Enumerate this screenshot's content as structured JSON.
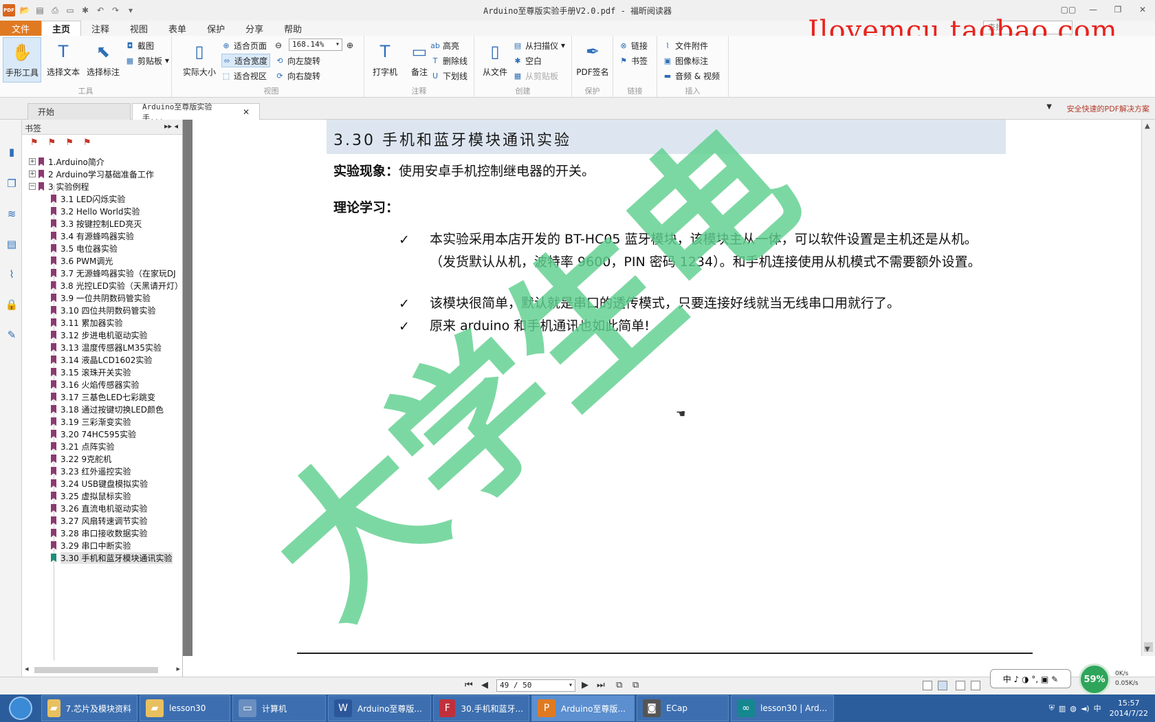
{
  "window": {
    "title": "Arduino至尊版实验手册V2.0.pdf - 福昕阅读器",
    "app_logo": "PDF",
    "controls": [
      "▢▢",
      "—",
      "❐",
      "✕"
    ]
  },
  "watermark_top": "Ilovemcu.taobao.com",
  "menu": {
    "tabs": [
      "文件",
      "主页",
      "注释",
      "视图",
      "表单",
      "保护",
      "分享",
      "帮助"
    ],
    "active": "主页",
    "search_placeholder": "查找"
  },
  "ribbon": {
    "tools": {
      "label": "工具",
      "hand": "手形工具",
      "select_text": "选择文本",
      "select_annot": "选择标注",
      "snapshot": "截图",
      "clipboard": "剪贴板"
    },
    "view": {
      "label": "视图",
      "actual_size": "实际大小",
      "fit_page": "适合页面",
      "fit_width": "适合宽度",
      "fit_visible": "适合视区",
      "zoom": "168.14%",
      "rotate_left": "向左旋转",
      "rotate_right": "向右旋转"
    },
    "comment": {
      "label": "注释",
      "typewriter": "打字机",
      "note": "备注",
      "highlight": "高亮",
      "strikeout": "删除线",
      "underline": "下划线"
    },
    "create": {
      "label": "创建",
      "from_file": "从文件",
      "from_scanner": "从扫描仪",
      "blank": "空白",
      "from_clipboard": "从剪贴板"
    },
    "protect": {
      "label": "保护",
      "pdf_sign": "PDF签名"
    },
    "link": {
      "label": "链接",
      "link": "链接",
      "bookmark": "书签"
    },
    "insert": {
      "label": "插入",
      "attachment": "文件附件",
      "image_annot": "图像标注",
      "av": "音频 & 视频"
    }
  },
  "doc_tabs": [
    {
      "label": "开始"
    },
    {
      "label": "Arduino至尊版实验手..."
    }
  ],
  "promo_text": "安全快速的PDF解决方案",
  "bookmarks": {
    "title": "书签",
    "top_level": [
      {
        "label": "1.Arduino简介",
        "exp": "+"
      },
      {
        "label": "2 Arduino学习基础准备工作",
        "exp": "+"
      },
      {
        "label": "3 实验例程",
        "exp": "−"
      }
    ],
    "children": [
      "3.1 LED闪烁实验",
      "3.2 Hello World实验",
      "3.3 按键控制LED亮灭",
      "3.4 有源蜂鸣器实验",
      "3.5 电位器实验",
      "3.6 PWM调光",
      "3.7 无源蜂鸣器实验（在家玩DJ",
      "3.8 光控LED实验（天黑请开灯）",
      "3.9 一位共阴数码管实验",
      "3.10 四位共阴数码管实验",
      "3.11 累加器实验",
      "3.12 步进电机驱动实验",
      "3.13 温度传感器LM35实验",
      "3.14 液晶LCD1602实验",
      "3.15 滚珠开关实验",
      "3.16 火焰传感器实验",
      "3.17 三基色LED七彩跳变",
      "3.18 通过按键切换LED颜色",
      "3.19 三彩渐变实验",
      "3.20 74HC595实验",
      "3.21 点阵实验",
      "3.22 9克舵机",
      "3.23 红外遥控实验",
      "3.24 USB键盘模拟实验",
      "3.25 虚拟鼠标实验",
      "3.26 直流电机驱动实验",
      "3.27 风扇转速调节实验",
      "3.28 串口接收数据实验",
      "3.29 串口中断实验",
      "3.30 手机和蓝牙模块通讯实验"
    ],
    "selected_index": 29
  },
  "page": {
    "section_title": "3.30  手机和蓝牙模块通讯实验",
    "phenomenon_label": "实验现象：",
    "phenomenon_text": "使用安卓手机控制继电器的开关。",
    "theory_label": "理论学习：",
    "bullets": [
      "本实验采用本店开发的 BT-HC05 蓝牙模块，该模块主从一体，可以软件设置是主机还是从机。（发货默认从机，波特率 9600，PIN 密码 1234）。和手机连接使用从机模式不需要额外设置。",
      "该模块很简单，默认就是串口的透传模式，只要连接好线就当无线串口用就行了。",
      "原来 arduino 和手机通讯也如此简单!"
    ],
    "checkmark": "✓",
    "stamp_text": "大学生电",
    "stamp_color": "#5fcf8f"
  },
  "status": {
    "page_indicator": "49 / 50",
    "network_percent": "59%",
    "upload": "0K/s",
    "download": "0.05K/s",
    "ime": "中 ♪ ◑ °, ▣ ✎"
  },
  "taskbar": {
    "items": [
      {
        "label": "7.芯片及模块资料",
        "icon": "folder-icon"
      },
      {
        "label": "lesson30",
        "icon": "folder-icon"
      },
      {
        "label": "计算机",
        "icon": "computer-icon"
      },
      {
        "label": "Arduino至尊版...",
        "icon": "word-icon"
      },
      {
        "label": "30.手机和蓝牙...",
        "icon": "app-icon"
      },
      {
        "label": "Arduino至尊版...",
        "icon": "pdf-icon"
      },
      {
        "label": "ECap",
        "icon": "camera-icon"
      },
      {
        "label": "lesson30 | Ard...",
        "icon": "arduino-icon"
      }
    ],
    "active_index": 5,
    "clock_time": "15:57",
    "clock_date": "2014/7/22",
    "tray_lang": "中"
  }
}
